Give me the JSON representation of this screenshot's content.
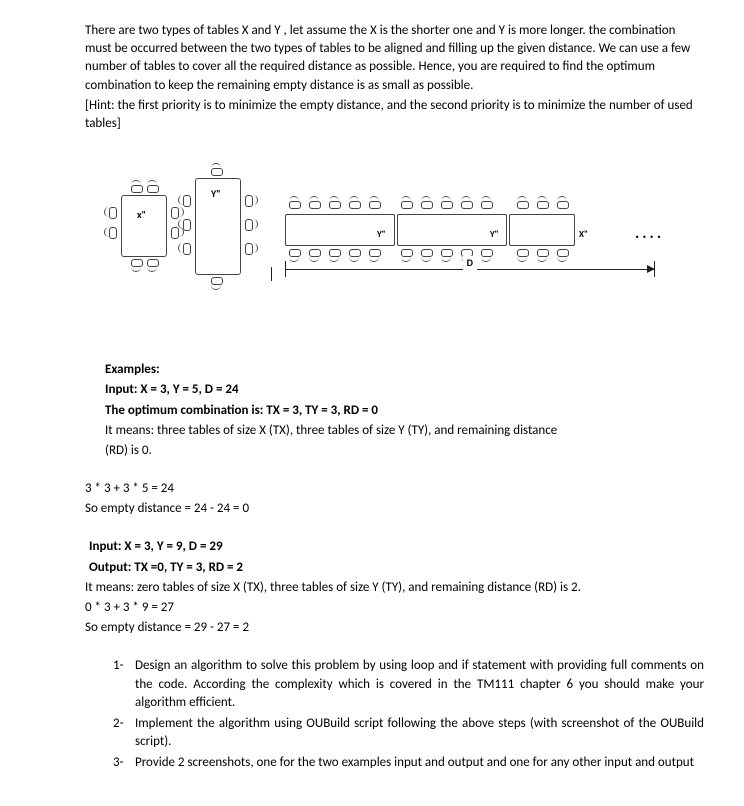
{
  "intro": {
    "p1": "There are two types of tables X and Y , let assume the X is the shorter one and Y is more longer. the combination must be occurred between the two types of tables to be aligned and filling up the given distance. We can use a few number of tables to cover all the required distance as possible. Hence, you are required to find the optimum combination to keep the remaining empty distance is as small as possible.",
    "hint": "[Hint: the first priority is to minimize the empty distance, and the second priority is to minimize the number of used tables]"
  },
  "diagram": {
    "x_label": "x\"",
    "y_label": "Y\"",
    "long_y1": "Y\"",
    "long_y2": "Y\"",
    "long_x": "X\"",
    "d_label": "D",
    "dots": "...."
  },
  "examples": {
    "heading": "Examples:",
    "ex1_input": "Input: X = 3, Y = 5, D = 24",
    "ex1_result": "The optimum combination is: TX = 3, TY = 3, RD = 0",
    "ex1_mean1": "It means: three tables of size X (TX), three tables of size Y (TY), and remaining distance",
    "ex1_mean2": "(RD) is 0.",
    "ex1_calc1": "3 * 3 + 3 * 5 = 24",
    "ex1_calc2": "So empty distance = 24 - 24 = 0",
    "ex2_input": "Input: X = 3, Y = 9, D = 29",
    "ex2_output": "Output: TX =0, TY = 3, RD = 2",
    "ex2_mean": "It means: zero tables of size X (TX), three tables of size Y (TY), and remaining distance (RD) is 2.",
    "ex2_calc1": "0 * 3 + 3 * 9 = 27",
    "ex2_calc2": "So empty distance = 29 - 27 = 2"
  },
  "tasks": {
    "n1": "1-",
    "t1": "Design an algorithm to solve this problem by using loop and if statement with providing full comments on the code. According the complexity which is covered in the TM111 chapter 6 you should make your algorithm efficient.",
    "n2": "2-",
    "t2": "Implement the algorithm using OUBuild script following the above steps (with screenshot of the OUBuild script).",
    "n3": "3-",
    "t3": "Provide 2 screenshots, one for the two examples input and output and one for any other input and output"
  }
}
